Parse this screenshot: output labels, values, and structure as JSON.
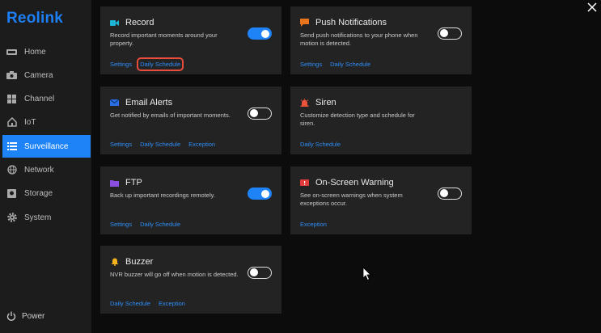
{
  "app": {
    "logo": "Reolink"
  },
  "sidebar": {
    "items": [
      {
        "label": "Home",
        "icon": "home-icon"
      },
      {
        "label": "Camera",
        "icon": "camera-icon"
      },
      {
        "label": "Channel",
        "icon": "channel-grid-icon"
      },
      {
        "label": "IoT",
        "icon": "iot-home-icon"
      },
      {
        "label": "Surveillance",
        "icon": "list-icon",
        "active": true
      },
      {
        "label": "Network",
        "icon": "globe-icon"
      },
      {
        "label": "Storage",
        "icon": "storage-icon"
      },
      {
        "label": "System",
        "icon": "gear-icon"
      }
    ],
    "power": "Power"
  },
  "cards": {
    "record": {
      "title": "Record",
      "desc": "Record important moments around your property.",
      "toggle": "on",
      "links": [
        "Settings",
        "Daily Schedule"
      ],
      "icon": "video-camera-icon",
      "icon_color": "#1db4d6"
    },
    "push": {
      "title": "Push Notifications",
      "desc": "Send push notifications to your phone when motion is detected.",
      "toggle": "off",
      "links": [
        "Settings",
        "Daily Schedule"
      ],
      "icon": "chat-bubble-icon",
      "icon_color": "#e8741c"
    },
    "email": {
      "title": "Email Alerts",
      "desc": "Get notified by emails of important moments.",
      "toggle": "off",
      "links": [
        "Settings",
        "Daily Schedule",
        "Exception"
      ],
      "icon": "envelope-icon",
      "icon_color": "#2a6fe6"
    },
    "siren": {
      "title": "Siren",
      "desc": "Customize detection type and schedule for siren.",
      "links": [
        "Daily Schedule"
      ],
      "icon": "siren-icon",
      "icon_color": "#e8533a"
    },
    "ftp": {
      "title": "FTP",
      "desc": "Back up important recordings remotely.",
      "toggle": "on",
      "links": [
        "Settings",
        "Daily Schedule"
      ],
      "icon": "folder-icon",
      "icon_color": "#8a4fe0"
    },
    "warning": {
      "title": "On-Screen Warning",
      "desc": "See on-screen warnings when system exceptions occur.",
      "toggle": "off",
      "links": [
        "Exception"
      ],
      "icon": "warning-screen-icon",
      "icon_color": "#e23b3b"
    },
    "buzzer": {
      "title": "Buzzer",
      "desc": "NVR buzzer will go off when motion is detected.",
      "toggle": "off",
      "links": [
        "Daily Schedule",
        "Exception"
      ],
      "icon": "bell-icon",
      "icon_color": "#f1b21d"
    }
  },
  "colors": {
    "accent": "#1e83f6",
    "highlight": "#e74c3c"
  }
}
